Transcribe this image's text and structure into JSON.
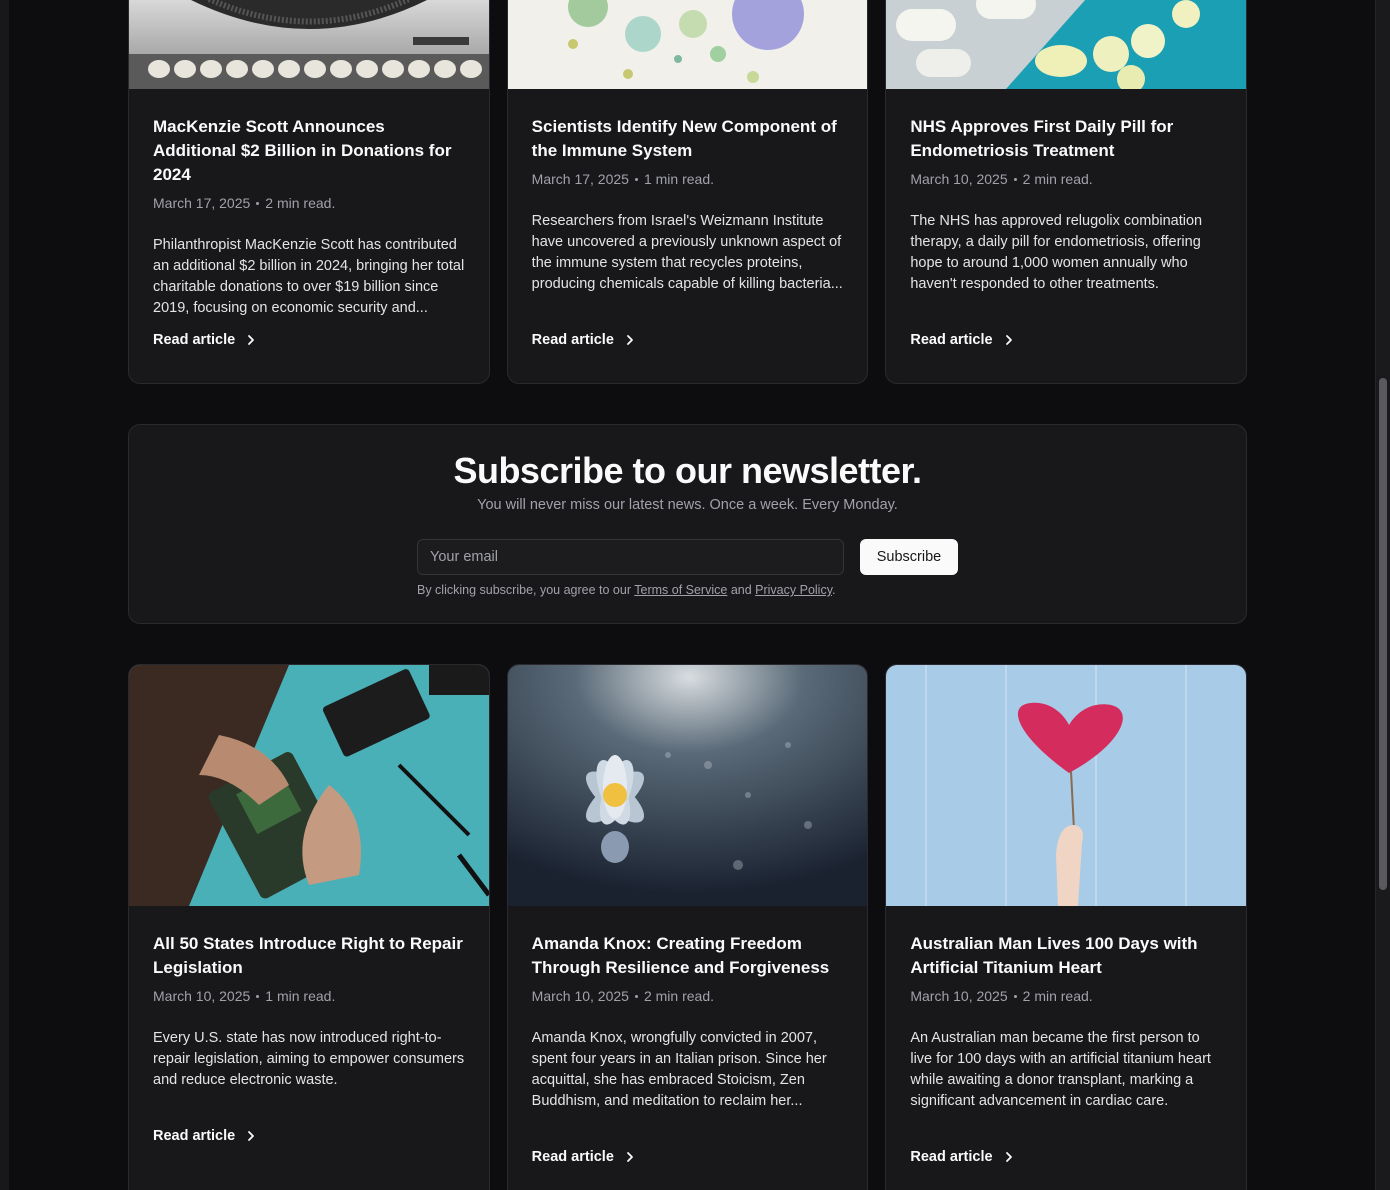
{
  "top_articles": [
    {
      "title": "MacKenzie Scott Announces Additional $2 Billion in Donations for 2024",
      "date": "March 17, 2025",
      "read_time": "2 min read.",
      "excerpt": "Philanthropist MacKenzie Scott has contributed an additional $2 billion in 2024, bringing her total charitable donations to over $19 billion since 2019, focusing on economic security and...",
      "link_label": "Read article",
      "image": "typewriter-photo"
    },
    {
      "title": "Scientists Identify New Component of the Immune System",
      "date": "March 17, 2025",
      "read_time": "1 min read.",
      "excerpt": "Researchers from Israel's Weizmann Institute have uncovered a previously unknown aspect of the immune system that recycles proteins, producing chemicals capable of killing bacteria...",
      "link_label": "Read article",
      "image": "virus-illustration"
    },
    {
      "title": "NHS Approves First Daily Pill for Endometriosis Treatment",
      "date": "March 10, 2025",
      "read_time": "2 min read.",
      "excerpt": "The NHS has approved relugolix combination therapy, a daily pill for endometriosis, offering hope to around 1,000 women annually who haven't responded to other treatments.",
      "link_label": "Read article",
      "image": "pills-photo"
    }
  ],
  "newsletter": {
    "title": "Subscribe to our newsletter.",
    "subtitle": "You will never miss our latest news. Once a week. Every Monday.",
    "email_placeholder": "Your email",
    "button_label": "Subscribe",
    "legal_prefix": "By clicking subscribe, you agree to our ",
    "terms_label": "Terms of Service",
    "legal_and": " and ",
    "privacy_label": "Privacy Policy",
    "legal_suffix": "."
  },
  "bottom_articles": [
    {
      "title": "All 50 States Introduce Right to Repair Legislation",
      "date": "March 10, 2025",
      "read_time": "1 min read.",
      "excerpt": "Every U.S. state has now introduced right-to-repair legislation, aiming to empower consumers and reduce electronic waste.",
      "link_label": "Read article",
      "image": "phone-repair-photo"
    },
    {
      "title": "Amanda Knox: Creating Freedom Through Resilience and Forgiveness",
      "date": "March 10, 2025",
      "read_time": "2 min read.",
      "excerpt": "Amanda Knox, wrongfully convicted in 2007, spent four years in an Italian prison. Since her acquittal, she has embraced Stoicism, Zen Buddhism, and meditation to reclaim her...",
      "link_label": "Read article",
      "image": "lotus-photo"
    },
    {
      "title": "Australian Man Lives 100 Days with Artificial Titanium Heart",
      "date": "March 10, 2025",
      "read_time": "2 min read.",
      "excerpt": "An Australian man became the first person to live for 100 days with an artificial titanium heart while awaiting a donor transplant, marking a significant advancement in cardiac care.",
      "link_label": "Read article",
      "image": "paper-heart-photo"
    }
  ],
  "colors": {
    "background": "#0d0d0f",
    "card": "#18181b",
    "border": "#2a2a2e",
    "muted_text": "#a1a1aa",
    "button_bg": "#fafafa"
  }
}
